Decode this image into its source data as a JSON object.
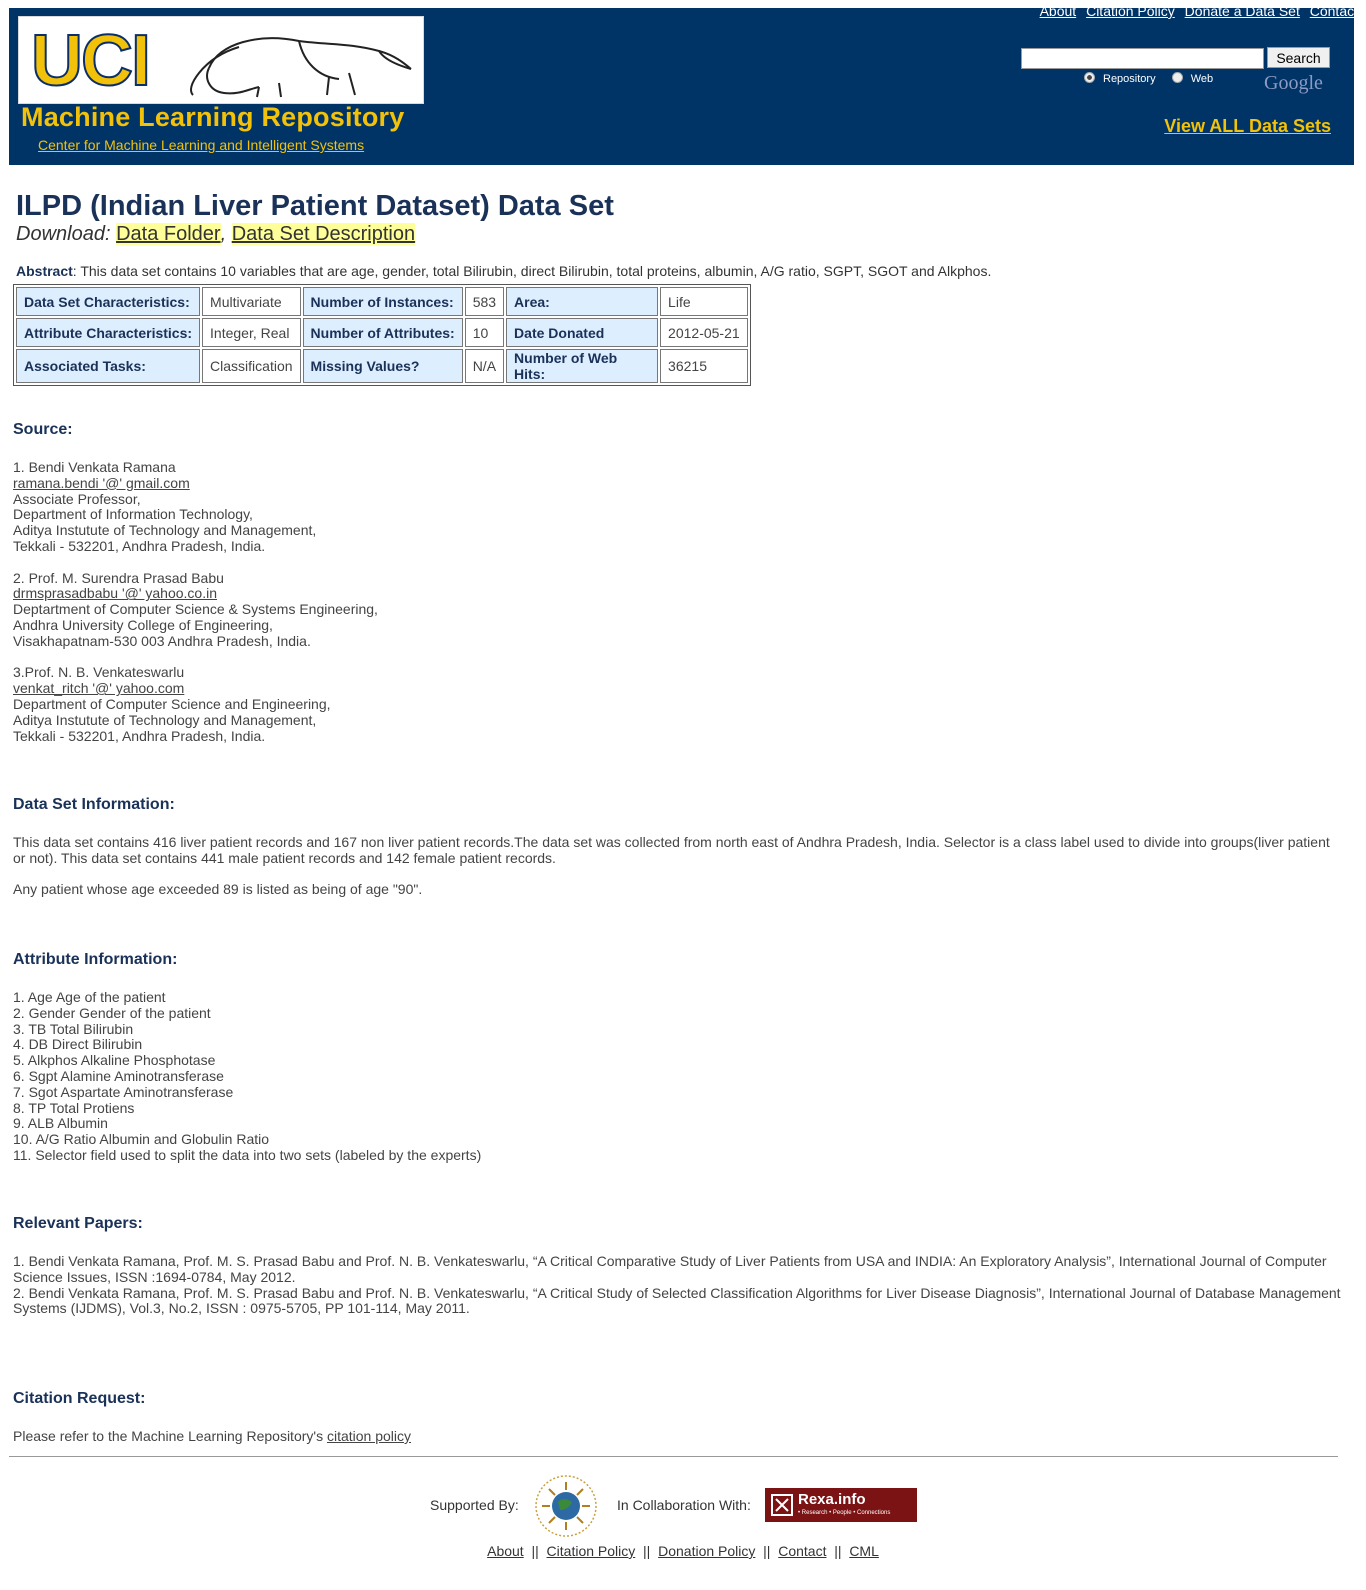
{
  "header": {
    "logo_text": "UCI",
    "site_title": "Machine Learning Repository",
    "site_subtitle": "Center for Machine Learning and Intelligent Systems",
    "top_links": [
      "About",
      "Citation Policy",
      "Donate a Data Set",
      "Contact"
    ],
    "search_button": "Search",
    "search_value": "",
    "radio_options": [
      "Repository",
      "Web"
    ],
    "radio_selected": "Repository",
    "google_label": "Google",
    "view_all": "View ALL Data Sets"
  },
  "dataset": {
    "title": "ILPD (Indian Liver Patient Dataset) Data Set",
    "download_label": "Download",
    "download_links": [
      "Data Folder",
      "Data Set Description"
    ],
    "abstract_label": "Abstract",
    "abstract": ": This data set contains 10 variables that are age, gender, total Bilirubin, direct Bilirubin, total proteins, albumin, A/G ratio, SGPT, SGOT and Alkphos.",
    "table": [
      [
        "Data Set Characteristics:",
        "Multivariate",
        "Number of Instances:",
        "583",
        "Area:",
        "Life"
      ],
      [
        "Attribute Characteristics:",
        "Integer, Real",
        "Number of Attributes:",
        "10",
        "Date Donated",
        "2012-05-21"
      ],
      [
        "Associated Tasks:",
        "Classification",
        "Missing Values?",
        "N/A",
        "Number of Web Hits:",
        "36215"
      ]
    ]
  },
  "source": {
    "heading": "Source:",
    "people": [
      {
        "name": "1. Bendi Venkata Ramana",
        "email": "ramana.bendi '@' gmail.com",
        "lines": [
          "Associate Professor,",
          "Department of Information Technology,",
          "Aditya Instutute of Technology and Management,",
          "Tekkali - 532201, Andhra Pradesh, India."
        ]
      },
      {
        "name": "2. Prof. M. Surendra Prasad Babu",
        "email": "drmsprasadbabu '@' yahoo.co.in",
        "lines": [
          "Deptartment of Computer Science & Systems Engineering,",
          "Andhra University College of Engineering,",
          "Visakhapatnam-530 003 Andhra Pradesh, India."
        ]
      },
      {
        "name": "3.Prof. N. B. Venkateswarlu",
        "email": "venkat_ritch '@' yahoo.com",
        "lines": [
          "Department of Computer Science and Engineering,",
          "Aditya Instutute of Technology and Management,",
          "Tekkali - 532201, Andhra Pradesh, India."
        ]
      }
    ]
  },
  "info": {
    "heading": "Data Set Information:",
    "p1": "This data set contains 416 liver patient records and 167 non liver patient records.The data set was collected from north east of Andhra Pradesh, India. Selector is a class label used to divide into groups(liver patient or not). This data set contains 441 male patient records and 142 female patient records.",
    "p2": "Any patient whose age exceeded 89 is listed as being of age \"90\"."
  },
  "attributes": {
    "heading": "Attribute Information:",
    "items": [
      "1. Age Age of the patient",
      "2. Gender Gender of the patient",
      "3. TB Total Bilirubin",
      "4. DB Direct Bilirubin",
      "5. Alkphos Alkaline Phosphotase",
      "6. Sgpt Alamine Aminotransferase",
      "7. Sgot Aspartate Aminotransferase",
      "8. TP Total Protiens",
      "9. ALB Albumin",
      "10. A/G Ratio Albumin and Globulin Ratio",
      "11. Selector field used to split the data into two sets (labeled by the experts)"
    ]
  },
  "papers": {
    "heading": "Relevant Papers:",
    "items": [
      "1. Bendi Venkata Ramana, Prof. M. S. Prasad Babu and Prof. N. B. Venkateswarlu, “A Critical Comparative Study of Liver Patients from USA and INDIA: An Exploratory Analysis”, International Journal of Computer Science Issues, ISSN :1694-0784, May 2012.",
      "2. Bendi Venkata Ramana, Prof. M. S. Prasad Babu and Prof. N. B. Venkateswarlu, “A Critical Study of Selected Classification Algorithms for Liver Disease Diagnosis”, International Journal of Database Management Systems (IJDMS), Vol.3, No.2, ISSN : 0975-5705, PP 101-114, May 2011."
    ]
  },
  "citation": {
    "heading": "Citation Request:",
    "text": "Please refer to the Machine Learning Repository's",
    "link": "citation policy"
  },
  "support": {
    "supported_by": "Supported By:",
    "collaboration": "In Collaboration With:",
    "rexa_text": "Rexa.info",
    "rexa_sub": "• Research • People • Connections",
    "nsf_text": "NATIONAL SCIENCE FOUNDATION"
  },
  "footer": {
    "links": [
      "About",
      "Citation Policy",
      "Donation Policy",
      "Contact",
      "CML"
    ],
    "separator": "||"
  }
}
